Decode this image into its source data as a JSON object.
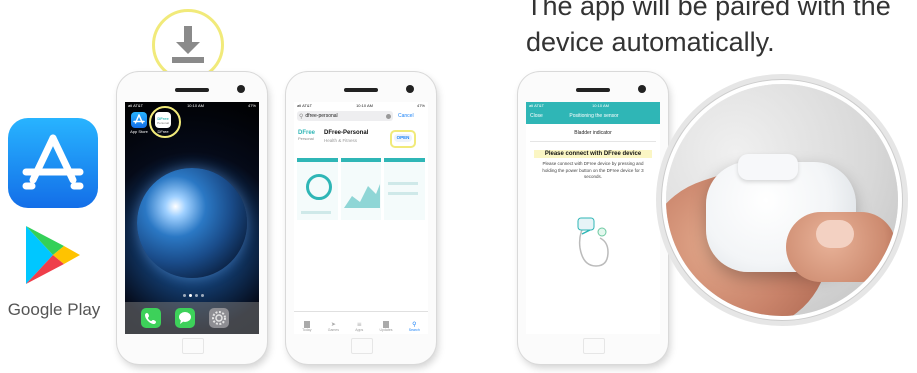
{
  "caption": {
    "line1": "The app will be paired with the",
    "line2": "device automatically."
  },
  "stores": {
    "google_play_label": "Google Play"
  },
  "phone1": {
    "status_left": "atl AT&T",
    "status_time": "10:10 AM",
    "status_right": "47%",
    "app_store_label": "App Store",
    "dfree_label": "DFree",
    "dfree_icon_text": "DFree",
    "dfree_icon_sub": "Personal"
  },
  "phone2": {
    "status_left": "atl AT&T",
    "status_time": "10:10 AM",
    "status_right": "47%",
    "search_value": "dfree-personal",
    "cancel_label": "Cancel",
    "app_title": "DFree-Personal",
    "app_category": "Health & Fitness",
    "logo_text": "DFree",
    "logo_sub": "Personal",
    "open_label": "OPEN",
    "tabs": [
      "Today",
      "Games",
      "Apps",
      "Updates",
      "Search"
    ]
  },
  "phone3": {
    "status_left": "atl AT&T",
    "status_time": "10:10 AM",
    "close_label": "Close",
    "nav_title": "Positioning the sensor",
    "section_title": "Bladder indicator",
    "connect_title": "Please connect with DFree device",
    "connect_body": "Please connect with DFree device by pressing and holding the power button on the DFree device for 3 seconds."
  },
  "colors": {
    "accent_teal": "#2fb6b6",
    "highlight_yellow": "#f1ea7a",
    "app_store_blue": "#1a8cf0",
    "ios_blue": "#1a82f7"
  }
}
